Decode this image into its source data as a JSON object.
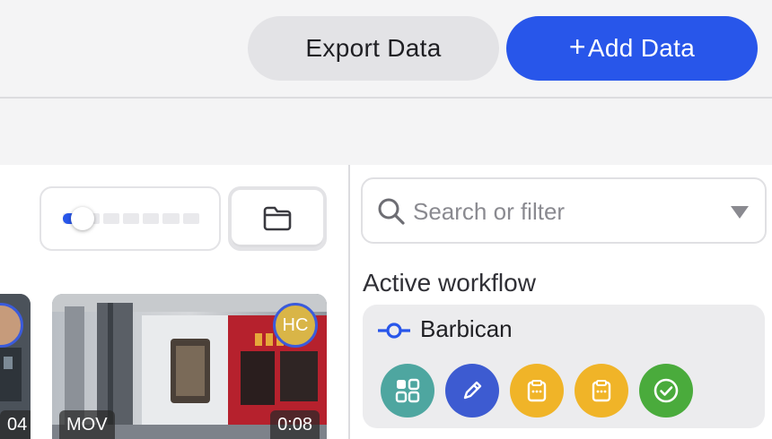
{
  "header": {
    "export_label": "Export Data",
    "add_plus": "+",
    "add_label": "Add Data"
  },
  "gallery": {
    "items": [
      {
        "duration": "04"
      },
      {
        "format": "MOV",
        "duration": "0:08",
        "assignee_initials": "HC"
      }
    ]
  },
  "sidebar": {
    "search": {
      "placeholder": "Search or filter"
    },
    "workflow_heading": "Active workflow",
    "workflow": {
      "name": "Barbican",
      "steps": [
        {
          "icon": "grid-icon",
          "color": "#4ea6a0"
        },
        {
          "icon": "pencil-icon",
          "color": "#3d5bd1"
        },
        {
          "icon": "clipboard-icon",
          "color": "#f0b428"
        },
        {
          "icon": "clipboard-icon",
          "color": "#f0b428"
        },
        {
          "icon": "check-circle-icon",
          "color": "#4aab3c"
        }
      ]
    }
  },
  "colors": {
    "accent": "#2856ea",
    "avatar_hc": "#d9b547"
  },
  "zoom_slider": {
    "level": 0.1
  }
}
